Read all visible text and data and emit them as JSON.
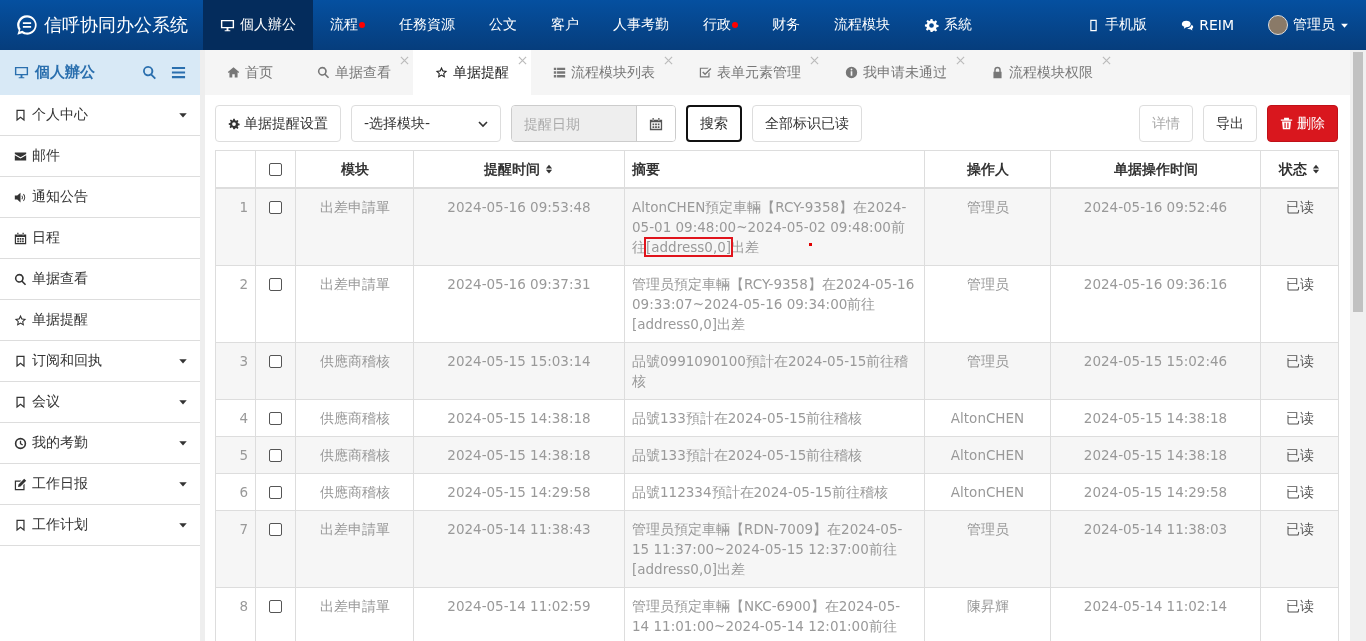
{
  "app": {
    "title": "信呼协同办公系统"
  },
  "nav": [
    {
      "label": "個人辦公",
      "selected": true,
      "badge": false
    },
    {
      "label": "流程",
      "selected": false,
      "badge": true
    },
    {
      "label": "任務資源",
      "selected": false,
      "badge": false
    },
    {
      "label": "公文",
      "selected": false,
      "badge": false
    },
    {
      "label": "客户",
      "selected": false,
      "badge": false
    },
    {
      "label": "人事考勤",
      "selected": false,
      "badge": false
    },
    {
      "label": "行政",
      "selected": false,
      "badge": true
    },
    {
      "label": "财务",
      "selected": false,
      "badge": false
    },
    {
      "label": "流程模块",
      "selected": false,
      "badge": false
    },
    {
      "label": "系統",
      "selected": false,
      "badge": false
    }
  ],
  "top_links": [
    {
      "label": "手机版"
    },
    {
      "label": "REIM"
    }
  ],
  "user": {
    "name": "管理员"
  },
  "sidebar": {
    "title": "個人辦公",
    "items": [
      {
        "label": "个人中心",
        "expandable": true
      },
      {
        "label": "邮件",
        "expandable": false
      },
      {
        "label": "通知公告",
        "expandable": false
      },
      {
        "label": "日程",
        "expandable": false
      },
      {
        "label": "单据查看",
        "expandable": false
      },
      {
        "label": "单据提醒",
        "expandable": false
      },
      {
        "label": "订阅和回执",
        "expandable": true
      },
      {
        "label": "会议",
        "expandable": true
      },
      {
        "label": "我的考勤",
        "expandable": true
      },
      {
        "label": "工作日报",
        "expandable": true
      },
      {
        "label": "工作计划",
        "expandable": true
      }
    ]
  },
  "tabs": [
    {
      "label": "首页",
      "selected": false,
      "closable": false
    },
    {
      "label": "单据查看",
      "selected": false,
      "closable": true
    },
    {
      "label": "单据提醒",
      "selected": true,
      "closable": true
    },
    {
      "label": "流程模块列表",
      "selected": false,
      "closable": true
    },
    {
      "label": "表单元素管理",
      "selected": false,
      "closable": true
    },
    {
      "label": "我申请未通过",
      "selected": false,
      "closable": true
    },
    {
      "label": "流程模块权限",
      "selected": false,
      "closable": true
    }
  ],
  "toolbar": {
    "settings_button": "单据提醒设置",
    "module_select": "-选择模块-",
    "date_field": {
      "placeholder": "提醒日期"
    },
    "search_button": "搜索",
    "mark_all_button": "全部标识已读",
    "detail_button": {
      "label": "详情",
      "disabled": true
    },
    "export_button": "导出",
    "delete_button": "删除"
  },
  "table": {
    "header_checkbox": {
      "checked": false
    },
    "columns": [
      {
        "label": "模块",
        "sortable": false
      },
      {
        "label": "提醒时间",
        "sortable": true
      },
      {
        "label": "摘要",
        "sortable": false
      },
      {
        "label": "操作人",
        "sortable": false
      },
      {
        "label": "单据操作时间",
        "sortable": false
      },
      {
        "label": "状态",
        "sortable": true
      }
    ],
    "rows": [
      {
        "index": "1",
        "checked": false,
        "module": "出差申請單",
        "remind_time": "2024-05-16 09:53:48",
        "summary": [
          {
            "text": "AltonCHEN預定車輛【RCY-9358】在2024-05-01 09:48:00~2024-05-02 09:48:00前往",
            "boxed": false
          },
          {
            "text": "[address0,0]",
            "boxed": true
          },
          {
            "text": "出差",
            "boxed": false
          }
        ],
        "marker": true,
        "operator": "管理员",
        "op_time": "2024-05-16 09:52:46",
        "status": "已读"
      },
      {
        "index": "2",
        "checked": false,
        "module": "出差申請單",
        "remind_time": "2024-05-16 09:37:31",
        "summary": [
          {
            "text": "管理员預定車輛【RCY-9358】在2024-05-16 09:33:07~2024-05-16 09:34:00前往[address0,0]出差",
            "boxed": false
          }
        ],
        "marker": false,
        "operator": "管理员",
        "op_time": "2024-05-16 09:36:16",
        "status": "已读"
      },
      {
        "index": "3",
        "checked": false,
        "module": "供應商稽核",
        "remind_time": "2024-05-15 15:03:14",
        "summary": [
          {
            "text": "品號0991090100預計在2024-05-15前往稽核",
            "boxed": false
          }
        ],
        "marker": false,
        "operator": "管理员",
        "op_time": "2024-05-15 15:02:46",
        "status": "已读"
      },
      {
        "index": "4",
        "checked": false,
        "module": "供應商稽核",
        "remind_time": "2024-05-15 14:38:18",
        "summary": [
          {
            "text": "品號133預計在2024-05-15前往稽核",
            "boxed": false
          }
        ],
        "marker": false,
        "operator": "AltonCHEN",
        "op_time": "2024-05-15 14:38:18",
        "status": "已读"
      },
      {
        "index": "5",
        "checked": false,
        "module": "供應商稽核",
        "remind_time": "2024-05-15 14:38:18",
        "summary": [
          {
            "text": "品號133預計在2024-05-15前往稽核",
            "boxed": false
          }
        ],
        "marker": false,
        "operator": "AltonCHEN",
        "op_time": "2024-05-15 14:38:18",
        "status": "已读"
      },
      {
        "index": "6",
        "checked": false,
        "module": "供應商稽核",
        "remind_time": "2024-05-15 14:29:58",
        "summary": [
          {
            "text": "品號112334預計在2024-05-15前往稽核",
            "boxed": false
          }
        ],
        "marker": false,
        "operator": "AltonCHEN",
        "op_time": "2024-05-15 14:29:58",
        "status": "已读"
      },
      {
        "index": "7",
        "checked": false,
        "module": "出差申請單",
        "remind_time": "2024-05-14 11:38:43",
        "summary": [
          {
            "text": "管理员預定車輛【RDN-7009】在2024-05-15 11:37:00~2024-05-15 12:37:00前往[address0,0]出差",
            "boxed": false
          }
        ],
        "marker": false,
        "operator": "管理员",
        "op_time": "2024-05-14 11:38:03",
        "status": "已读"
      },
      {
        "index": "8",
        "checked": false,
        "module": "出差申請單",
        "remind_time": "2024-05-14 11:02:59",
        "summary": [
          {
            "text": "管理员預定車輛【NKC-6900】在2024-05-14 11:01:00~2024-05-14 12:01:00前往",
            "boxed": false
          }
        ],
        "marker": false,
        "operator": "陳昇輝",
        "op_time": "2024-05-14 11:02:14",
        "status": "已读"
      }
    ]
  }
}
